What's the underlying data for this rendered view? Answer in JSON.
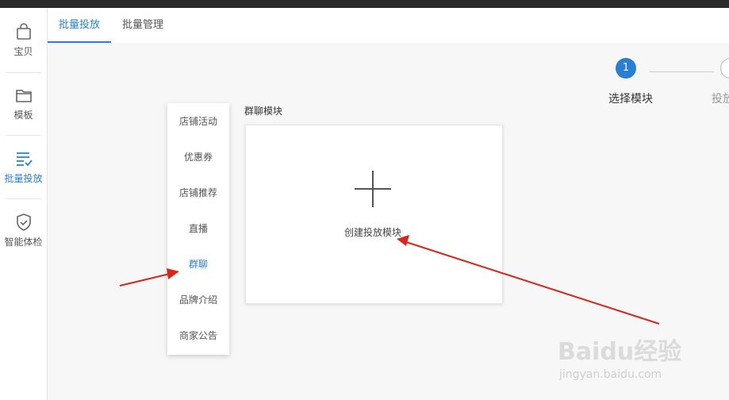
{
  "rail": {
    "items": [
      {
        "label": "宝贝",
        "icon": "bag-icon"
      },
      {
        "label": "模板",
        "icon": "folder-icon"
      },
      {
        "label": "批量投放",
        "icon": "list-check-icon",
        "active": true
      },
      {
        "label": "智能体检",
        "icon": "shield-check-icon"
      }
    ]
  },
  "tabs": [
    {
      "label": "批量投放",
      "active": true
    },
    {
      "label": "批量管理",
      "active": false
    }
  ],
  "steps": {
    "step1_number": "1",
    "step1_label": "选择模块",
    "step2_label": "投放"
  },
  "categories": [
    {
      "label": "店铺活动"
    },
    {
      "label": "优惠券"
    },
    {
      "label": "店铺推荐"
    },
    {
      "label": "直播"
    },
    {
      "label": "群聊",
      "active": true
    },
    {
      "label": "品牌介绍"
    },
    {
      "label": "商家公告"
    }
  ],
  "module": {
    "title": "群聊模块",
    "create_label": "创建投放模块"
  },
  "watermark": {
    "main": "Baidu经验",
    "sub": "jingyan.baidu.com"
  },
  "colors": {
    "accent": "#2a7fd3",
    "arrow": "#d9251c"
  }
}
